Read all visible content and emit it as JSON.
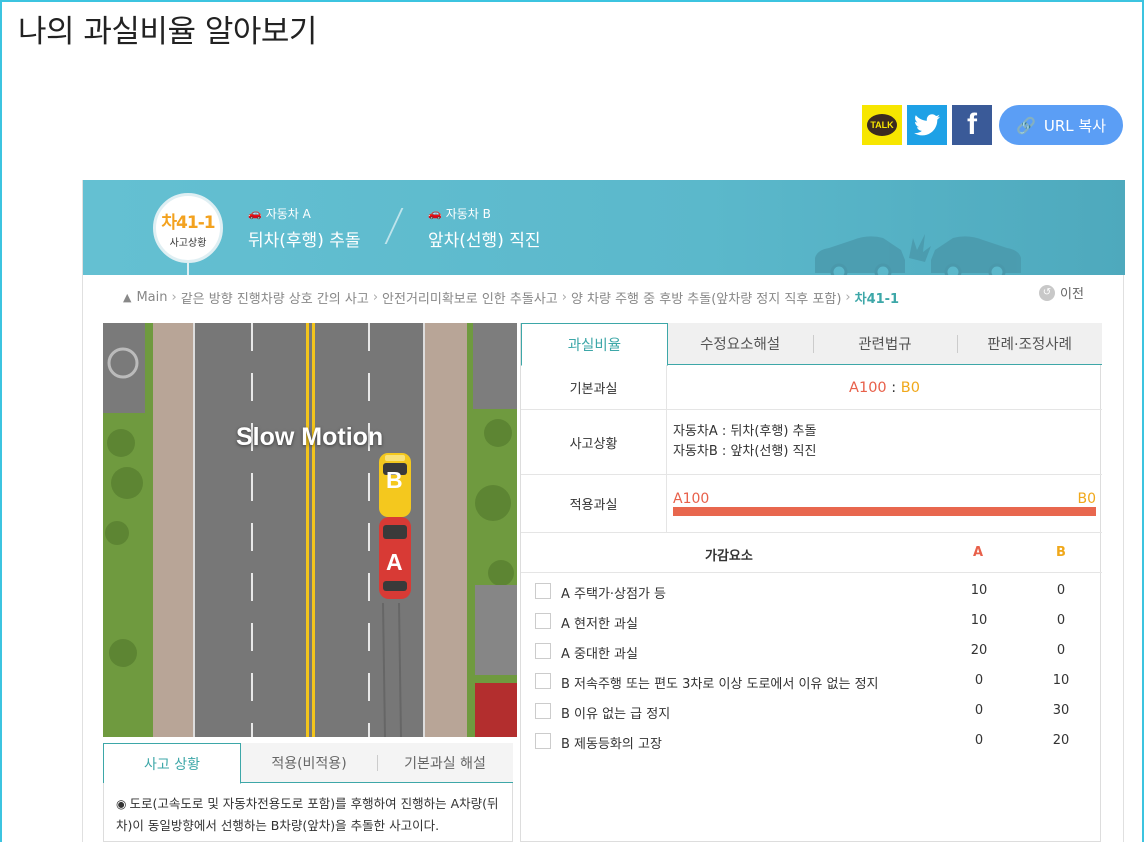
{
  "page_title": "나의 과실비율 알아보기",
  "share": {
    "kakao_label": "TALK",
    "url_copy_label": "URL 복사"
  },
  "banner": {
    "code": "차41-1",
    "code_sub": "사고상황",
    "vehicle_a_label": "자동차 A",
    "vehicle_a_desc": "뒤차(후행) 추돌",
    "vehicle_b_label": "자동차 B",
    "vehicle_b_desc": "앞차(선행) 직진"
  },
  "breadcrumb": {
    "items": [
      "Main",
      "같은 방향 진행차량 상호 간의 사고",
      "안전거리미확보로 인한 추돌사고",
      "양 차량 주행 중 후방 추돌(앞차량 정지 직후 포함)"
    ],
    "current": "차41-1",
    "prev_label": "이전"
  },
  "animation": {
    "overlay_text": "Slow Motion",
    "car_a": "A",
    "car_b": "B"
  },
  "sub_tabs": [
    "사고 상황",
    "적용(비적용)",
    "기본과실 해설"
  ],
  "situation_text": "도로(고속도로 및 자동차전용도로 포함)를 후행하여 진행하는 A차량(뒤차)이 동일방향에서 선행하는 B차량(앞차)을 추돌한 사고이다.",
  "tabs": [
    "과실비율",
    "수정요소해설",
    "관련법규",
    "판례·조정사례"
  ],
  "info": {
    "basic_label": "기본과실",
    "basic_a": "A100",
    "basic_colon": " : ",
    "basic_b": "B0",
    "situation_label": "사고상황",
    "situation_a": "자동차A : 뒤차(후행) 추돌",
    "situation_b": "자동차B : 앞차(선행) 직진",
    "applied_label": "적용과실",
    "applied_a": "A100",
    "applied_b": "B0",
    "applied_a_fraction": 1.0
  },
  "adjust": {
    "header": "가감요소",
    "col_a": "A",
    "col_b": "B",
    "rows": [
      {
        "label": "A 주택가·상점가 등",
        "a": "10",
        "b": "0"
      },
      {
        "label": "A 현저한 과실",
        "a": "10",
        "b": "0"
      },
      {
        "label": "A 중대한 과실",
        "a": "20",
        "b": "0"
      },
      {
        "label": "B 저속주행 또는 편도 3차로 이상 도로에서 이유 없는 정지",
        "a": "0",
        "b": "10"
      },
      {
        "label": "B 이유 없는 급 정지",
        "a": "0",
        "b": "30"
      },
      {
        "label": "B 제동등화의 고장",
        "a": "0",
        "b": "20"
      }
    ]
  },
  "colors": {
    "accent": "#3da7a8",
    "party_a": "#e8604a",
    "party_b": "#f0a81b",
    "banner": "#5bb8cb",
    "url_button": "#5b9ef5"
  }
}
